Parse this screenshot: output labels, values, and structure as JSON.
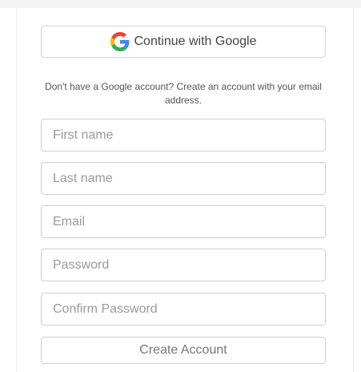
{
  "google_button": {
    "label": "Continue with Google",
    "icon": "google-logo-icon"
  },
  "helper_text": "Don't have a Google account? Create an account with your email address.",
  "form": {
    "fields": [
      {
        "name": "first-name",
        "placeholder": "First name",
        "value": ""
      },
      {
        "name": "last-name",
        "placeholder": "Last name",
        "value": ""
      },
      {
        "name": "email",
        "placeholder": "Email",
        "value": ""
      },
      {
        "name": "password",
        "placeholder": "Password",
        "value": ""
      },
      {
        "name": "confirm-password",
        "placeholder": "Confirm Password",
        "value": ""
      }
    ],
    "submit_label": "Create Account"
  },
  "colors": {
    "google_blue": "#4285F4",
    "google_red": "#EA4335",
    "google_yellow": "#FBBC05",
    "google_green": "#34A853"
  }
}
